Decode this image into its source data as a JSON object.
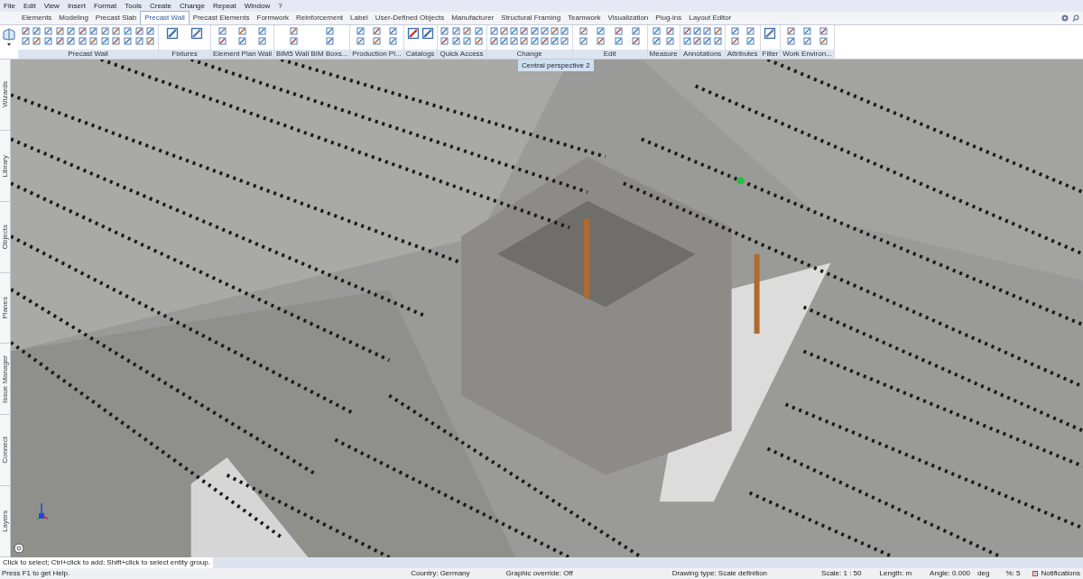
{
  "menu": [
    "File",
    "Edit",
    "View",
    "Insert",
    "Format",
    "Tools",
    "Create",
    "Change",
    "Repeat",
    "Window",
    "?"
  ],
  "tabs": [
    {
      "label": "Elements",
      "selected": false
    },
    {
      "label": "Modeling",
      "selected": false
    },
    {
      "label": "Precast Slab",
      "selected": false
    },
    {
      "label": "Precast Wall",
      "selected": true
    },
    {
      "label": "Precast Elements",
      "selected": false
    },
    {
      "label": "Formwork",
      "selected": false
    },
    {
      "label": "Reinforcement",
      "selected": false
    },
    {
      "label": "Label",
      "selected": false
    },
    {
      "label": "User-Defined Objects",
      "selected": false
    },
    {
      "label": "Manufacturer",
      "selected": false
    },
    {
      "label": "Structural Framing",
      "selected": false
    },
    {
      "label": "Teamwork",
      "selected": false
    },
    {
      "label": "Visualization",
      "selected": false
    },
    {
      "label": "Plug-ins",
      "selected": false
    },
    {
      "label": "Layout Editor",
      "selected": false
    }
  ],
  "ribbon_groups": [
    "Precast Wall",
    "Fixtures",
    "Element Plan Wall",
    "BIM5 Wall BIM Boxs...",
    "Production Pl...",
    "Catalogs",
    "Quick Access",
    "Change",
    "Edit",
    "Measure",
    "Annotations",
    "Attributes",
    "Filter",
    "Work Environ..."
  ],
  "side_tabs": [
    "Wizards",
    "Library",
    "Objects",
    "Planes",
    "Issue Manager",
    "Connect",
    "Layers"
  ],
  "viewport": {
    "view_label": "Central perspective 2"
  },
  "prompt": "Click to select; Ctrl+click to add; Shift+click to select entity group.",
  "status_bar": [
    {
      "text": "Press F1 to get Help."
    },
    {
      "text": "Country:  Germany"
    },
    {
      "text": "Graphic override:  Off"
    },
    {
      "text": "Drawing type:  Scale definition"
    },
    {
      "text": "Scale:  1 : 50"
    },
    {
      "text": "Length:  m"
    },
    {
      "text": "Angle:  0.000"
    },
    {
      "text": "deg"
    },
    {
      "text": "%:  5"
    },
    {
      "text": "Notifications"
    }
  ]
}
